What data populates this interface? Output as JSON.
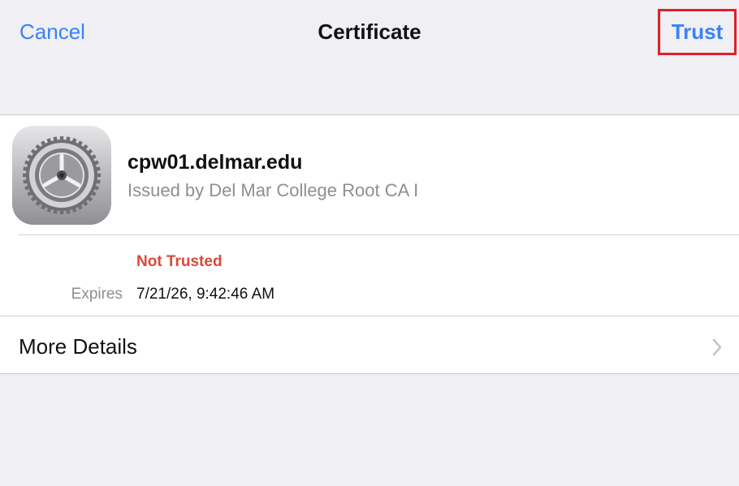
{
  "nav": {
    "cancel_label": "Cancel",
    "title": "Certificate",
    "trust_label": "Trust"
  },
  "certificate": {
    "host": "cpw01.delmar.edu",
    "issuer": "Issued by Del Mar College Root CA I",
    "icon": "settings-gear-icon",
    "status": "Not Trusted",
    "expires_label": "Expires",
    "expires_value": "7/21/26, 9:42:46 AM"
  },
  "details": {
    "more_label": "More Details",
    "chevron_icon": "chevron-right-icon"
  },
  "colors": {
    "accent": "#3a82f7",
    "danger": "#d9493a",
    "highlight": "#e0202a",
    "background": "#efeff4"
  }
}
